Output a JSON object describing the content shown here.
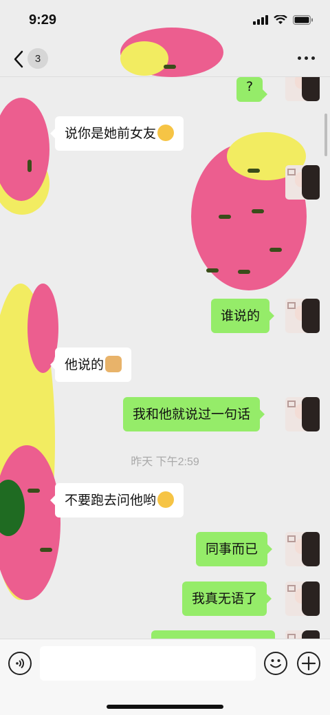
{
  "status_bar": {
    "time": "9:29"
  },
  "nav": {
    "unread_count": "3"
  },
  "messages": [
    {
      "side": "out",
      "text": "?"
    },
    {
      "side": "in",
      "text": "说你是她前女友",
      "emoji": "dizzy-face-emoji"
    },
    {
      "side": "out",
      "text": "谁说的"
    },
    {
      "side": "in",
      "text": "他说的",
      "emoji": "dog-face-emoji"
    },
    {
      "side": "out",
      "text": "我和他就说过一句话"
    },
    {
      "side": "in",
      "text": "不要跑去问他哟",
      "emoji": "laughing-crying-emoji"
    },
    {
      "side": "out",
      "text": "同事而已"
    },
    {
      "side": "out",
      "text": "我真无语了"
    }
  ],
  "timestamp": "昨天 下午2:59",
  "input": {
    "placeholder": ""
  },
  "colors": {
    "outgoing_bubble": "#95ec69",
    "incoming_bubble": "#ffffff",
    "background": "#ededed"
  }
}
